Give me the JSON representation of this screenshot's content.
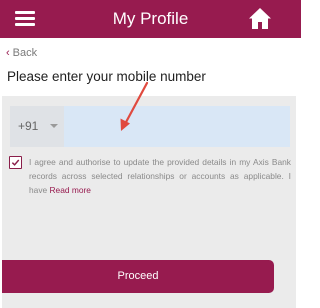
{
  "header": {
    "title": "My Profile",
    "menu_icon": "hamburger-menu-icon",
    "home_icon": "home-icon",
    "background_color": "#971b4f"
  },
  "nav": {
    "back_label": "Back",
    "back_icon": "chevron-left-icon"
  },
  "page": {
    "title": "Please enter your mobile number"
  },
  "phone": {
    "country_code": "+91",
    "value": ""
  },
  "consent": {
    "checked": true,
    "text": "I agree and authorise to update the provided details in my Axis Bank records across selected relationships or accounts as applicable. I have ",
    "read_more": "Read more"
  },
  "actions": {
    "proceed_label": "Proceed"
  }
}
